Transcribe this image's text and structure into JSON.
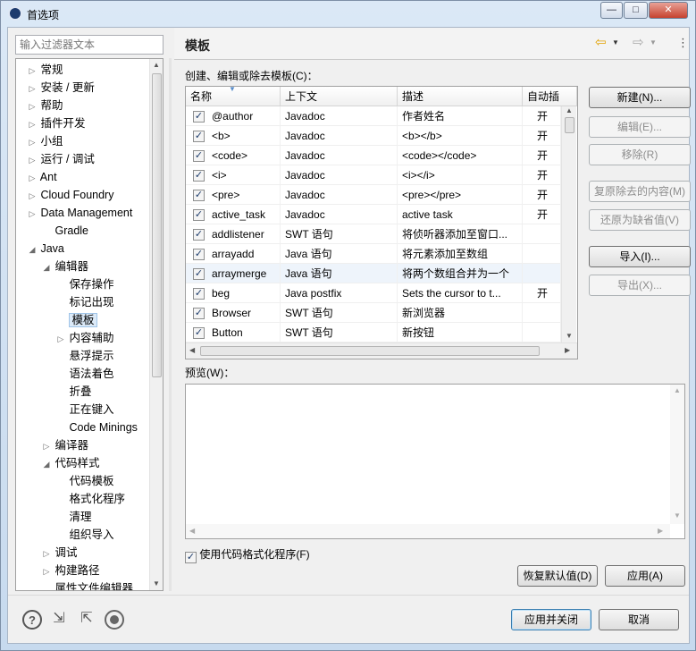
{
  "window": {
    "title": "首选项",
    "minimize": "—",
    "maximize": "□",
    "close": "✕"
  },
  "filter": {
    "placeholder": "输入过滤器文本"
  },
  "tree": {
    "items": [
      {
        "label": "常规",
        "twisty": "▷"
      },
      {
        "label": "安装 / 更新",
        "twisty": "▷"
      },
      {
        "label": "帮助",
        "twisty": "▷"
      },
      {
        "label": "插件开发",
        "twisty": "▷"
      },
      {
        "label": "小组",
        "twisty": "▷"
      },
      {
        "label": "运行 / 调试",
        "twisty": "▷"
      },
      {
        "label": "Ant",
        "twisty": "▷"
      },
      {
        "label": "Cloud Foundry",
        "twisty": "▷"
      },
      {
        "label": "Data Management",
        "twisty": "▷"
      },
      {
        "label": "Gradle",
        "twisty": ""
      },
      {
        "label": "Java",
        "twisty": "◢"
      },
      {
        "label": "编辑器",
        "twisty": "◢"
      },
      {
        "label": "保存操作",
        "twisty": ""
      },
      {
        "label": "标记出现",
        "twisty": ""
      },
      {
        "label": "模板",
        "twisty": ""
      },
      {
        "label": "内容辅助",
        "twisty": "▷"
      },
      {
        "label": "悬浮提示",
        "twisty": ""
      },
      {
        "label": "语法着色",
        "twisty": ""
      },
      {
        "label": "折叠",
        "twisty": ""
      },
      {
        "label": "正在键入",
        "twisty": ""
      },
      {
        "label": "Code Minings",
        "twisty": ""
      },
      {
        "label": "编译器",
        "twisty": "▷"
      },
      {
        "label": "代码样式",
        "twisty": "◢"
      },
      {
        "label": "代码模板",
        "twisty": ""
      },
      {
        "label": "格式化程序",
        "twisty": ""
      },
      {
        "label": "清理",
        "twisty": ""
      },
      {
        "label": "组织导入",
        "twisty": ""
      },
      {
        "label": "调试",
        "twisty": "▷"
      },
      {
        "label": "构建路径",
        "twisty": "▷"
      },
      {
        "label": "属性文件编辑器",
        "twisty": ""
      }
    ]
  },
  "page": {
    "title": "模板",
    "table_caption": "创建、编辑或除去模板(C)：",
    "preview_caption": "预览(W)：",
    "use_formatter": "使用代码格式化程序(F)"
  },
  "table": {
    "columns": [
      "名称",
      "上下文",
      "描述",
      "自动插"
    ],
    "rows": [
      {
        "name": "@author",
        "context": "Javadoc",
        "desc": "作者姓名",
        "auto": "开"
      },
      {
        "name": "<b>",
        "context": "Javadoc",
        "desc": "<b></b>",
        "auto": "开"
      },
      {
        "name": "<code>",
        "context": "Javadoc",
        "desc": "<code></code>",
        "auto": "开"
      },
      {
        "name": "<i>",
        "context": "Javadoc",
        "desc": "<i></i>",
        "auto": "开"
      },
      {
        "name": "<pre>",
        "context": "Javadoc",
        "desc": "<pre></pre>",
        "auto": "开"
      },
      {
        "name": "active_task",
        "context": "Javadoc",
        "desc": "active task",
        "auto": "开"
      },
      {
        "name": "addlistener",
        "context": "SWT 语句",
        "desc": "将侦听器添加至窗口...",
        "auto": ""
      },
      {
        "name": "arrayadd",
        "context": "Java 语句",
        "desc": "将元素添加至数组",
        "auto": ""
      },
      {
        "name": "arraymerge",
        "context": "Java 语句",
        "desc": "将两个数组合并为一个",
        "auto": ""
      },
      {
        "name": "beg",
        "context": "Java postfix",
        "desc": "Sets the cursor to t...",
        "auto": "开"
      },
      {
        "name": "Browser",
        "context": "SWT 语句",
        "desc": "新浏览器",
        "auto": ""
      },
      {
        "name": "Button",
        "context": "SWT 语句",
        "desc": "新按钮",
        "auto": ""
      }
    ]
  },
  "buttons": {
    "new": "新建(N)...",
    "edit": "编辑(E)...",
    "remove": "移除(R)",
    "restore_removed": "复原除去的内容(M)",
    "revert_default": "还原为缺省值(V)",
    "import": "导入(I)...",
    "export": "导出(X)...",
    "restore_defaults": "恢复默认值(D)",
    "apply": "应用(A)",
    "apply_close": "应用并关闭",
    "cancel": "取消"
  },
  "icons": {
    "help": "?",
    "import_prefs": "⇲",
    "export_prefs": "⇱",
    "record": ""
  },
  "colors": {
    "accent": "#3c7fb1",
    "nav_back": "#e2a100"
  }
}
